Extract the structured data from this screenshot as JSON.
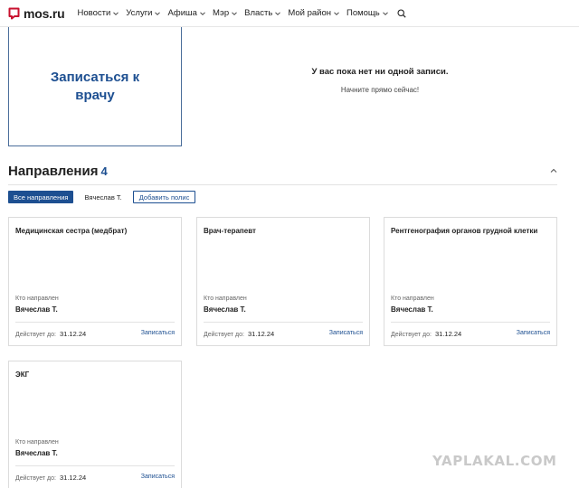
{
  "header": {
    "logo_text": "mos.ru",
    "nav": [
      {
        "label": "Новости",
        "dropdown": true
      },
      {
        "label": "Услуги",
        "dropdown": true
      },
      {
        "label": "Афиша",
        "dropdown": true
      },
      {
        "label": "Мэр",
        "dropdown": true
      },
      {
        "label": "Власть",
        "dropdown": true
      },
      {
        "label": "Мой район",
        "dropdown": true
      },
      {
        "label": "Помощь",
        "dropdown": true
      }
    ]
  },
  "appointment": {
    "card_title": "Записаться к врачу",
    "empty_title": "У вас пока нет ни одной записи.",
    "empty_sub": "Начните прямо сейчас!"
  },
  "referrals": {
    "title": "Направления",
    "count": "4",
    "filters": {
      "all": "Все направления",
      "person": "Вячеслав Т.",
      "add_policy": "Добавить полис"
    },
    "cards": [
      {
        "title": "Медицинская сестра (медбрат)",
        "ref_label": "Кто направлен",
        "ref_name": "Вячеслав Т.",
        "valid_label": "Действует до:",
        "valid_date": "31.12.24",
        "action": "Записаться"
      },
      {
        "title": "Врач-терапевт",
        "ref_label": "Кто направлен",
        "ref_name": "Вячеслав Т.",
        "valid_label": "Действует до:",
        "valid_date": "31.12.24",
        "action": "Записаться"
      },
      {
        "title": "Рентгенография органов грудной клетки",
        "ref_label": "Кто направлен",
        "ref_name": "Вячеслав Т.",
        "valid_label": "Действует до:",
        "valid_date": "31.12.24",
        "action": "Записаться"
      },
      {
        "title": "ЭКГ",
        "ref_label": "Кто направлен",
        "ref_name": "Вячеслав Т.",
        "valid_label": "Действует до:",
        "valid_date": "31.12.24",
        "action": "Записаться"
      }
    ]
  },
  "watermark": "YAPLAKAL.COM",
  "colors": {
    "accent": "#1d4f91",
    "brand": "#c8102e"
  }
}
